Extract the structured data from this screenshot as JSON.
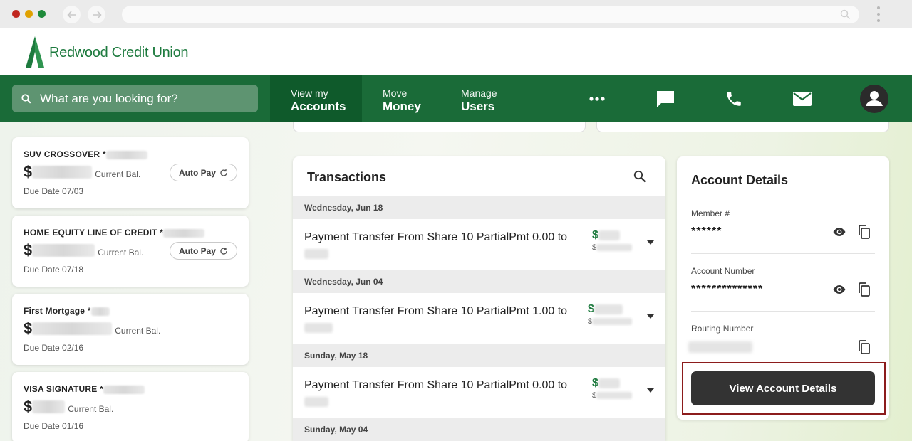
{
  "app": {
    "brand": "Redwood Credit Union",
    "brand_color": "#1a6b38",
    "search_placeholder": "What are you looking for?"
  },
  "nav": {
    "tabs": [
      {
        "small": "View my",
        "big": "Accounts",
        "active": true
      },
      {
        "small": "Move",
        "big": "Money",
        "active": false
      },
      {
        "small": "Manage",
        "big": "Users",
        "active": false
      }
    ],
    "icons": [
      "more-icon",
      "chat-icon",
      "phone-icon",
      "mail-icon",
      "profile-icon"
    ]
  },
  "accounts": [
    {
      "name": "SUV CROSSOVER",
      "bal_label": "Current Bal.",
      "due": "Due Date 07/03",
      "autopay": "Auto Pay"
    },
    {
      "name": "HOME EQUITY LINE OF CREDIT",
      "bal_label": "Current Bal.",
      "due": "Due Date 07/18",
      "autopay": "Auto Pay"
    },
    {
      "name": "First Mortgage",
      "bal_label": "Current Bal.",
      "due": "Due Date 02/16",
      "autopay": ""
    },
    {
      "name": "VISA SIGNATURE",
      "bal_label": "Current Bal.",
      "due": "Due Date 01/16",
      "autopay": ""
    }
  ],
  "symbols": {
    "dollar": "$",
    "asterisk": "*"
  },
  "transactions": {
    "title": "Transactions",
    "groups": [
      {
        "date": "Wednesday, Jun 18",
        "desc": "Payment Transfer From Share 10 PartialPmt 0.00 to"
      },
      {
        "date": "Wednesday, Jun 04",
        "desc": "Payment Transfer From Share 10 PartialPmt 1.00 to"
      },
      {
        "date": "Sunday, May 18",
        "desc": "Payment Transfer From Share 10 PartialPmt 0.00 to"
      },
      {
        "date": "Sunday, May 04",
        "desc": ""
      }
    ]
  },
  "account_details": {
    "title": "Account Details",
    "member_label": "Member #",
    "member_value": "******",
    "account_label": "Account Number",
    "account_value": "**************",
    "routing_label": "Routing Number",
    "button": "View Account Details"
  }
}
